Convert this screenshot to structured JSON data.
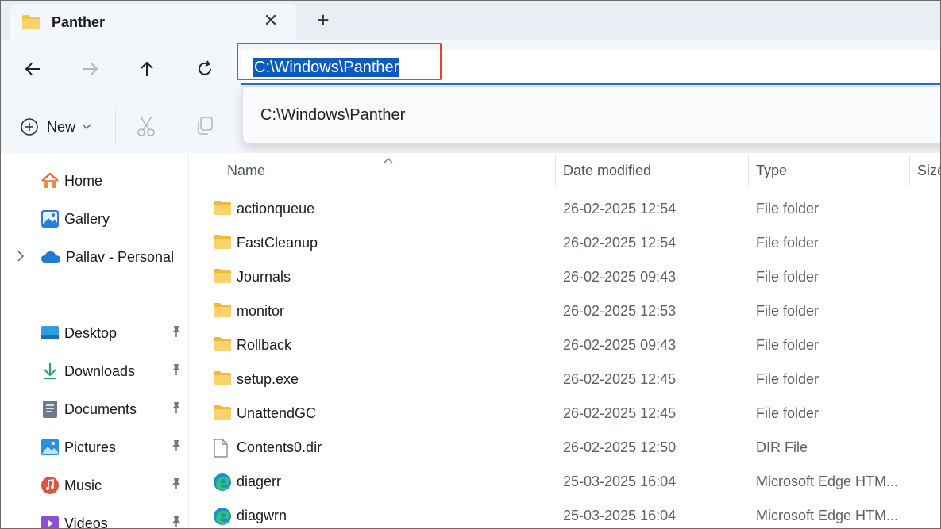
{
  "tab": {
    "title": "Panther",
    "close_icon": "close-icon",
    "new_tab_icon": "plus-icon"
  },
  "address": {
    "value": "C:\\Windows\\Panther"
  },
  "suggestion": {
    "item": "C:\\Windows\\Panther"
  },
  "toolbar": {
    "new_label": "New"
  },
  "sidebar": {
    "items": [
      {
        "label": "Home",
        "icon": "home-icon"
      },
      {
        "label": "Gallery",
        "icon": "gallery-icon"
      },
      {
        "label": "Pallav - Personal",
        "icon": "onedrive-cloud-icon"
      }
    ],
    "quick_access": [
      {
        "label": "Desktop",
        "icon": "desktop-icon"
      },
      {
        "label": "Downloads",
        "icon": "download-icon"
      },
      {
        "label": "Documents",
        "icon": "document-icon"
      },
      {
        "label": "Pictures",
        "icon": "pictures-icon"
      },
      {
        "label": "Music",
        "icon": "music-icon"
      },
      {
        "label": "Videos",
        "icon": "videos-icon"
      }
    ]
  },
  "columns": {
    "name": "Name",
    "date": "Date modified",
    "type": "Type",
    "size": "Size"
  },
  "files": [
    {
      "name": "actionqueue",
      "date": "26-02-2025 12:54",
      "type": "File folder",
      "icon": "folder-icon"
    },
    {
      "name": "FastCleanup",
      "date": "26-02-2025 12:54",
      "type": "File folder",
      "icon": "folder-icon"
    },
    {
      "name": "Journals",
      "date": "26-02-2025 09:43",
      "type": "File folder",
      "icon": "folder-icon"
    },
    {
      "name": "monitor",
      "date": "26-02-2025 12:53",
      "type": "File folder",
      "icon": "folder-icon"
    },
    {
      "name": "Rollback",
      "date": "26-02-2025 09:43",
      "type": "File folder",
      "icon": "folder-icon"
    },
    {
      "name": "setup.exe",
      "date": "26-02-2025 12:45",
      "type": "File folder",
      "icon": "folder-icon"
    },
    {
      "name": "UnattendGC",
      "date": "26-02-2025 12:45",
      "type": "File folder",
      "icon": "folder-icon"
    },
    {
      "name": "Contents0.dir",
      "date": "26-02-2025 12:50",
      "type": "DIR File",
      "icon": "file-icon"
    },
    {
      "name": "diagerr",
      "date": "25-03-2025 16:04",
      "type": "Microsoft Edge HTM...",
      "icon": "edge-icon"
    },
    {
      "name": "diagwrn",
      "date": "25-03-2025 16:04",
      "type": "Microsoft Edge HTM...",
      "icon": "edge-icon"
    }
  ],
  "colors": {
    "accent": "#0b5cbe",
    "highlight_border": "#e0403a",
    "folder": "#f4c542"
  }
}
